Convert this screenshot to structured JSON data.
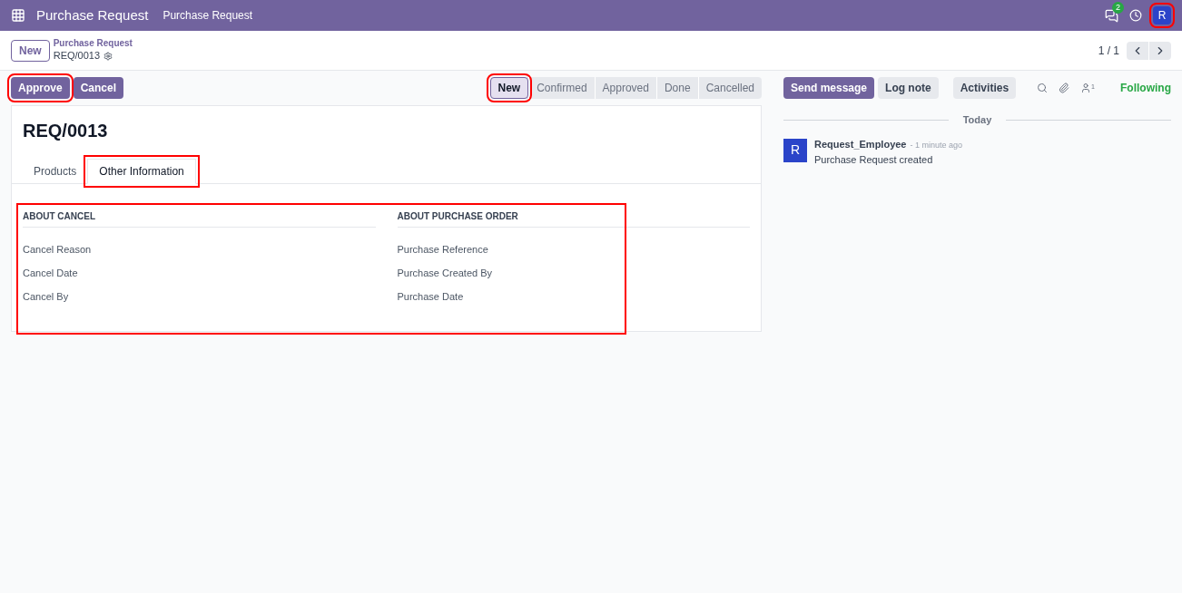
{
  "navbar": {
    "app_title": "Purchase Request",
    "menu": [
      "Purchase Request"
    ],
    "message_count": "2",
    "avatar": "R",
    "avatar_highlighted": true
  },
  "breadcrumb": {
    "new_button": "New",
    "parent": "Purchase Request",
    "current": "REQ/0013",
    "pager": "1 / 1"
  },
  "actions": [
    {
      "label": "Approve",
      "highlighted": true
    },
    {
      "label": "Cancel",
      "highlighted": false
    }
  ],
  "stages": [
    {
      "label": "New",
      "selected": true,
      "highlighted": true
    },
    {
      "label": "Confirmed",
      "selected": false,
      "highlighted": false
    },
    {
      "label": "Approved",
      "selected": false,
      "highlighted": false
    },
    {
      "label": "Done",
      "selected": false,
      "highlighted": false
    },
    {
      "label": "Cancelled",
      "selected": false,
      "highlighted": false
    }
  ],
  "record_title": "REQ/0013",
  "tabs": [
    {
      "label": "Products",
      "selected": false,
      "highlighted": false
    },
    {
      "label": "Other Information",
      "selected": true,
      "highlighted": true
    }
  ],
  "groups_highlighted": true,
  "groups": [
    {
      "title": "ABOUT CANCEL",
      "fields": [
        "Cancel Reason",
        "Cancel Date",
        "Cancel By"
      ]
    },
    {
      "title": "ABOUT PURCHASE ORDER",
      "fields": [
        "Purchase Reference",
        "Purchase Created By",
        "Purchase Date"
      ]
    }
  ],
  "chatter": {
    "buttons": [
      {
        "label": "Send message",
        "kind": "primary"
      },
      {
        "label": "Log note",
        "kind": "secondary"
      },
      {
        "label": "Activities",
        "kind": "secondary"
      }
    ],
    "followers_count": "1",
    "following": "Following",
    "date_separator": "Today",
    "messages": [
      {
        "avatar": "R",
        "author": "Request_Employee",
        "time": "- 1 minute ago",
        "body": "Purchase Request created"
      }
    ]
  }
}
